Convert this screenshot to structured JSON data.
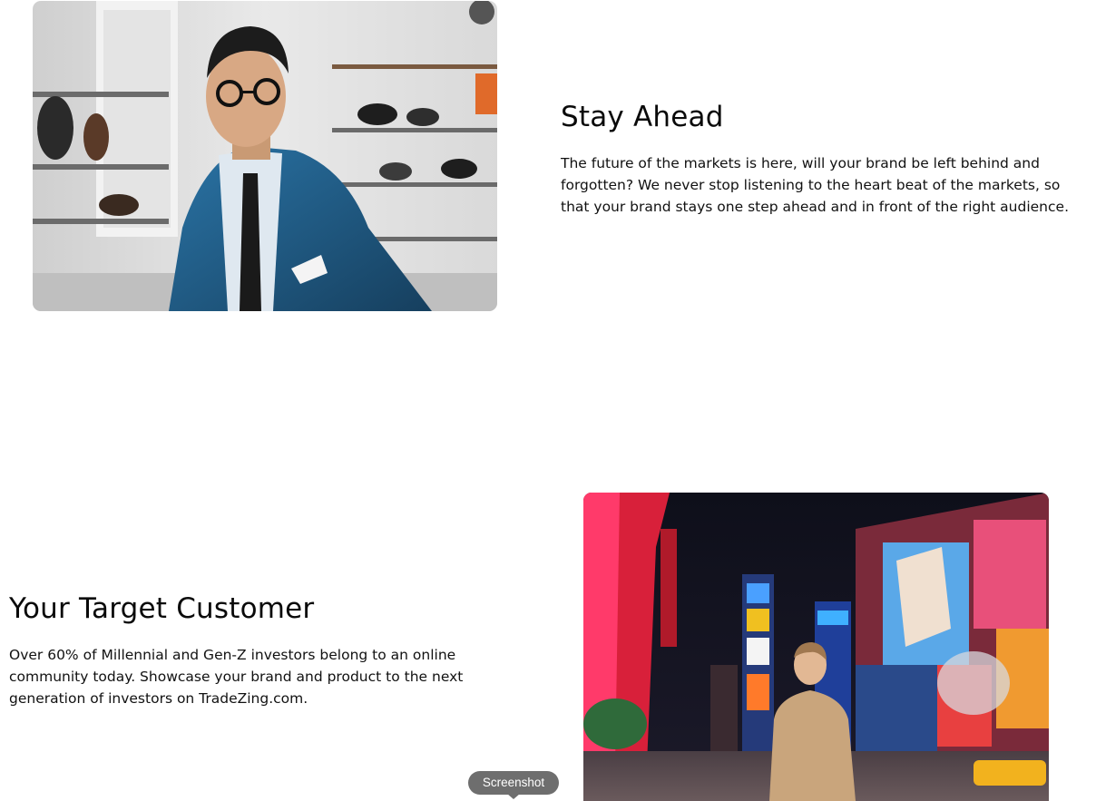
{
  "sections": [
    {
      "title": "Stay Ahead",
      "body": "The future of the markets is here, will your brand be left behind and forgotten? We never stop listening to the heart beat of the markets, so that your brand stays one step ahead and in front of the right audience."
    },
    {
      "title": "Your Target Customer",
      "body": "Over 60% of Millennial and Gen-Z investors belong to an online community today. Showcase your brand and product to the next generation of investors on TradeZing.com."
    }
  ],
  "tooltip": {
    "label": "Screenshot"
  },
  "colors": {
    "text": "#0a0a0a",
    "tooltip_bg": "#6e6e6e",
    "blazer": "#1f5c86",
    "hoodie": "#c9a57c"
  }
}
